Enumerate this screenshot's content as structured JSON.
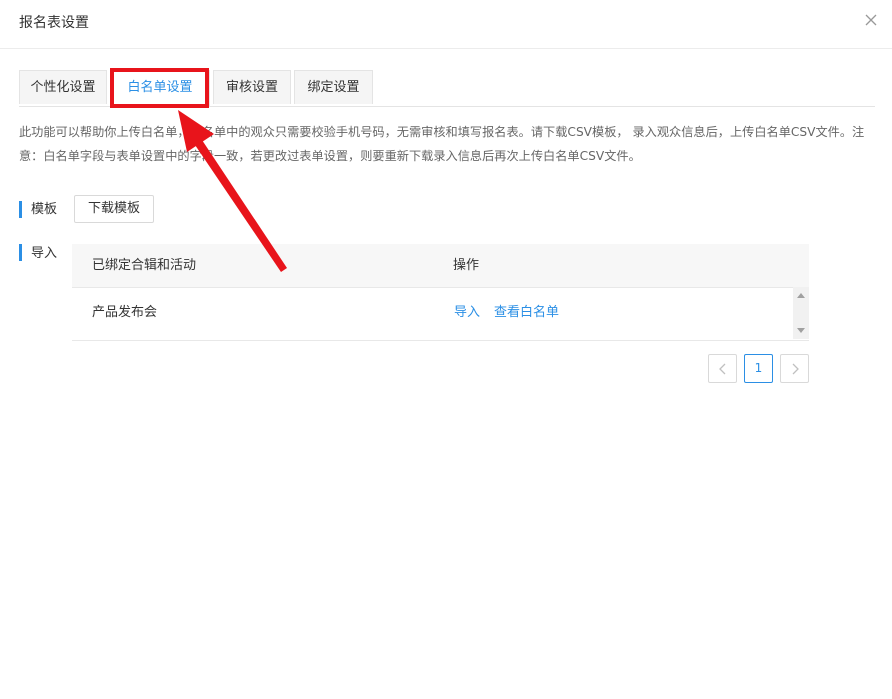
{
  "dialog": {
    "title": "报名表设置"
  },
  "tabs": [
    {
      "label": "个性化设置",
      "active": false
    },
    {
      "label": "白名单设置",
      "active": true
    },
    {
      "label": "审核设置",
      "active": false
    },
    {
      "label": "绑定设置",
      "active": false
    }
  ],
  "description": "此功能可以帮助你上传白名单，白名单中的观众只需要校验手机号码，无需审核和填写报名表。请下载CSV模板， 录入观众信息后，上传白名单CSV文件。注意：白名单字段与表单设置中的字段一致，若更改过表单设置，则要重新下载录入信息后再次上传白名单CSV文件。",
  "template_section": {
    "label": "模板",
    "button_label": "下载模板"
  },
  "import_section": {
    "label": "导入",
    "table": {
      "headers": [
        "已绑定合辑和活动",
        "操作"
      ],
      "rows": [
        {
          "name": "产品发布会",
          "actions": [
            "导入",
            "查看白名单"
          ]
        }
      ]
    }
  },
  "pagination": {
    "current_page": "1"
  },
  "colors": {
    "accent": "#2b8fe5",
    "highlight": "#e8141b"
  }
}
